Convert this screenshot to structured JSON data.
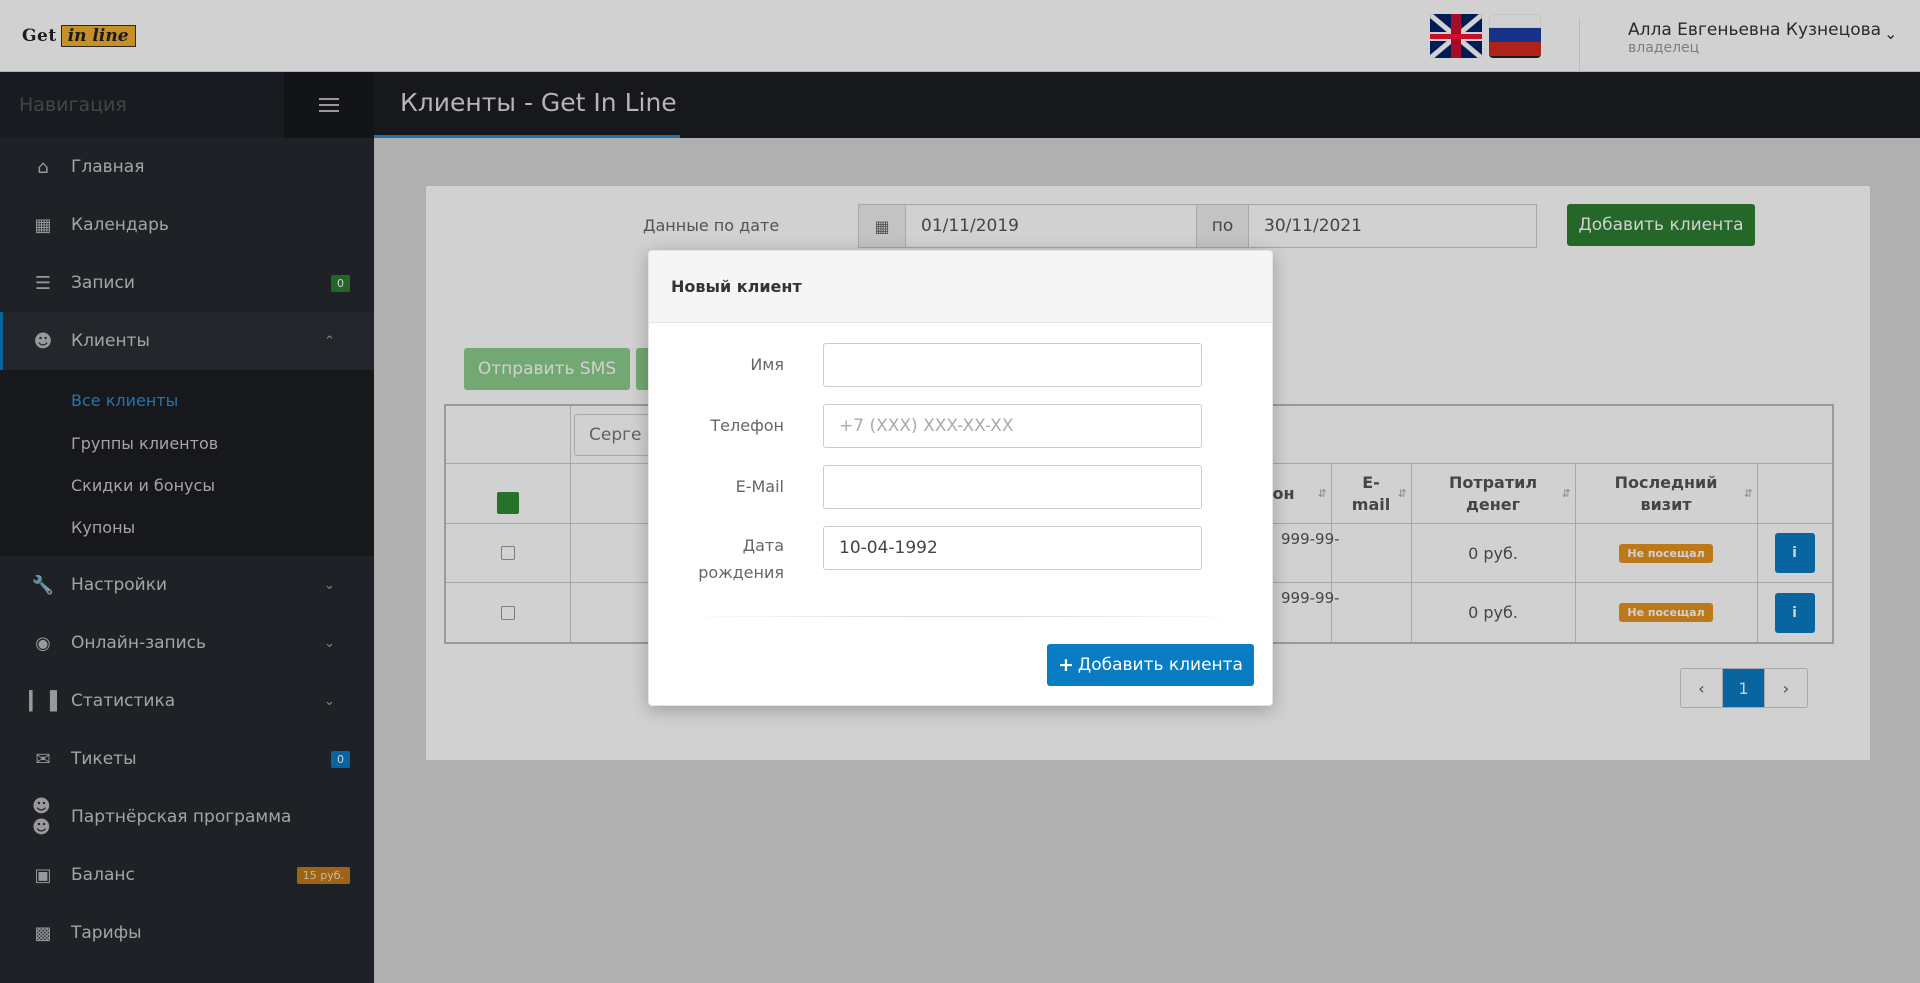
{
  "header": {
    "logo_get": "Get",
    "logo_inline": "in line",
    "user_name": "Алла Евгеньевна Кузнецова",
    "user_role": "владелец"
  },
  "sidebar": {
    "title": "Навигация",
    "items": [
      {
        "label": "Главная",
        "icon": "home-icon"
      },
      {
        "label": "Календарь",
        "icon": "calendar-icon"
      },
      {
        "label": "Записи",
        "icon": "list-icon",
        "badge": "0"
      },
      {
        "label": "Клиенты",
        "icon": "user-icon"
      },
      {
        "label": "Настройки",
        "icon": "wrench-icon"
      },
      {
        "label": "Онлайн-запись",
        "icon": "globe-icon"
      },
      {
        "label": "Статистика",
        "icon": "bar-chart-icon"
      },
      {
        "label": "Тикеты",
        "icon": "envelope-icon",
        "badge": "0"
      },
      {
        "label": "Партнёрская программа",
        "icon": "users-icon"
      },
      {
        "label": "Баланс",
        "icon": "money-icon",
        "badge": "15 руб."
      },
      {
        "label": "Тарифы",
        "icon": "briefcase-icon"
      }
    ],
    "clients_sub": [
      "Все клиенты",
      "Группы клиентов",
      "Скидки и бонусы",
      "Купоны"
    ]
  },
  "page": {
    "title": "Клиенты - Get In Line",
    "date_label": "Данные по дате",
    "date_from": "01/11/2019",
    "date_po": "по",
    "date_to": "30/11/2021",
    "add_client": "Добавить клиента",
    "send_sms": "Отправить SMS",
    "search_value": "Серге"
  },
  "table": {
    "headers": {
      "phone": "он",
      "email": "E-mail",
      "spent": "Потратил денег",
      "last_visit": "Последний визит"
    },
    "rows": [
      {
        "phone": "999-99-",
        "spent": "0 руб.",
        "status": "Не посещал"
      },
      {
        "phone": "999-99-",
        "spent": "0 руб.",
        "status": "Не посещал"
      }
    ]
  },
  "pagination": {
    "prev": "‹",
    "current": "1",
    "next": "›"
  },
  "modal": {
    "title": "Новый клиент",
    "name_label": "Имя",
    "name_value": "",
    "phone_label": "Телефон",
    "phone_placeholder": "+7 (XXX) XXX-XX-XX",
    "email_label": "E-Mail",
    "email_value": "",
    "birth_label_1": "Дата",
    "birth_label_2": "рождения",
    "birth_value": "10-04-1992",
    "submit": "Добавить клиента"
  }
}
